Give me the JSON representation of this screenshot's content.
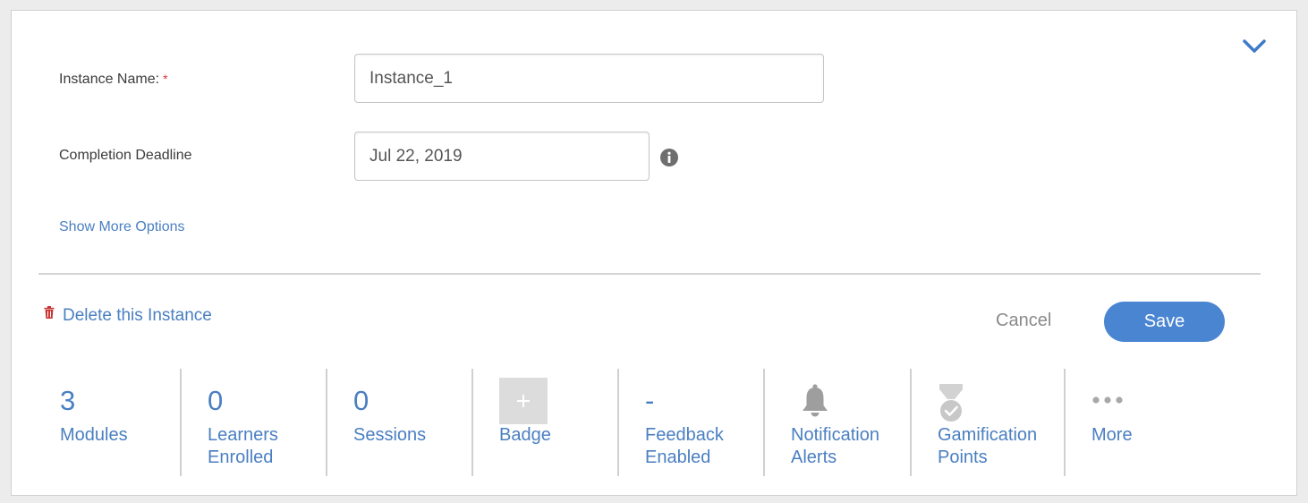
{
  "form": {
    "instance_name_label": "Instance Name:",
    "required_marker": "*",
    "instance_name_value": "Instance_1",
    "completion_deadline_label": "Completion Deadline",
    "completion_deadline_value": "Jul 22, 2019",
    "show_more_options": "Show More Options"
  },
  "actions": {
    "delete_label": "Delete this Instance",
    "cancel_label": "Cancel",
    "save_label": "Save"
  },
  "stats": [
    {
      "value": "3",
      "label": "Modules"
    },
    {
      "value": "0",
      "label_lines": [
        "Learners",
        "Enrolled"
      ]
    },
    {
      "value": "0",
      "label": "Sessions"
    },
    {
      "icon": "badge-add-icon",
      "label": "Badge"
    },
    {
      "value": "-",
      "label_lines": [
        "Feedback",
        "Enabled"
      ]
    },
    {
      "icon": "bell-icon",
      "label_lines": [
        "Notification",
        "Alerts"
      ]
    },
    {
      "icon": "medal-icon",
      "label_lines": [
        "Gamification",
        "Points"
      ]
    },
    {
      "icon": "ellipsis-icon",
      "label": "More"
    }
  ],
  "colors": {
    "link": "#4a7fc1",
    "primary_button": "#4a85d2",
    "required": "#d93636",
    "delete_icon": "#c83232",
    "muted_icon": "#9e9e9e"
  }
}
